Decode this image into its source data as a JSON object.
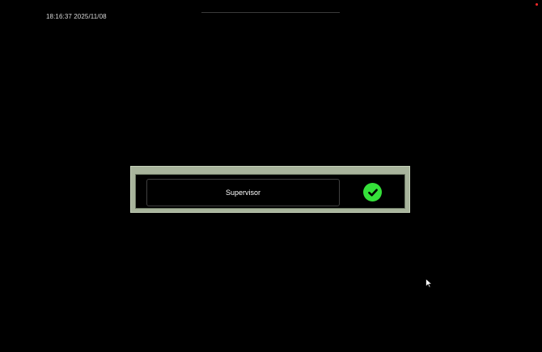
{
  "status_bar": {
    "clock_text": "18:16:37 2025/11/08"
  },
  "login": {
    "user_value": "Supervisor",
    "confirm_icon": "checkmark-icon"
  },
  "colors": {
    "background": "#000000",
    "panel_frame": "#a8b49c",
    "confirm_green": "#35e03a",
    "alert_dot": "#ff2a2a"
  }
}
